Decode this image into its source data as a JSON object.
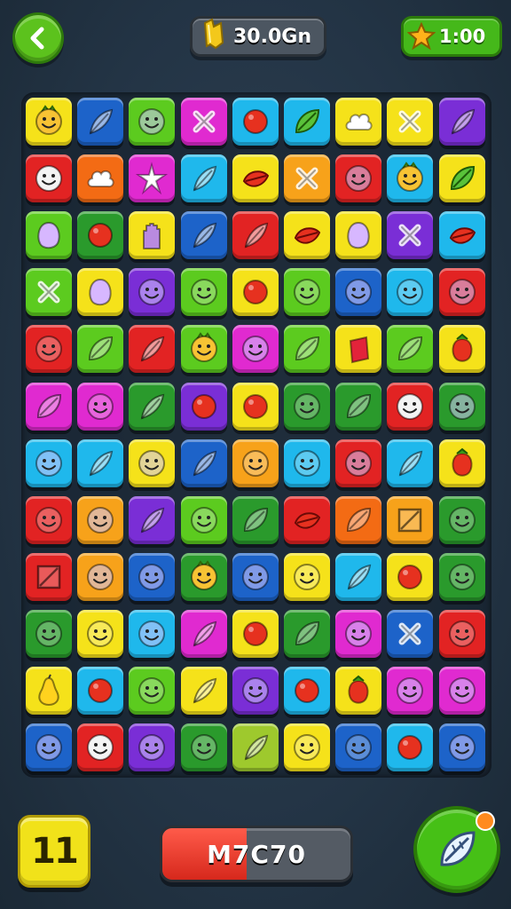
{
  "header": {
    "back_icon": "back-arrow-icon",
    "currency_icon": "gold-bar-icon",
    "currency_value": "30.0Gn",
    "timer_icon": "star-icon",
    "timer_value": "1:00"
  },
  "footer": {
    "level_value": "11",
    "score_value": "M7C70",
    "score_fill_percent": 45,
    "booster_icon": "leaf-booster-icon"
  },
  "colors": {
    "Y": "#f5e21a",
    "B": "#1d63c9",
    "L": "#5ccb1f",
    "M": "#e02ad0",
    "C": "#1fb8ec",
    "R": "#e22323",
    "O": "#f36b14",
    "P": "#7a2ed6",
    "D": "#2a9a2c",
    "A": "#f7a21a",
    "W": "#9ec92d"
  },
  "board": {
    "rows": [
      [
        "Y:pineapple-face",
        "B:feather",
        "L:blob-face",
        "M:cross",
        "C:red-blob",
        "C:green-leaf",
        "Y:cloud",
        "Y:cross",
        "P:feather"
      ],
      [
        "R:white-face",
        "O:cloud",
        "M:star",
        "C:feather",
        "Y:red-leaf",
        "A:cross",
        "R:blob-face",
        "C:pineapple-face",
        "Y:green-leaf"
      ],
      [
        "L:blob",
        "D:red-blob",
        "Y:hand",
        "B:feather",
        "R:feather",
        "Y:red-leaf",
        "Y:blob",
        "P:cross",
        "C:red-leaf"
      ],
      [
        "L:cross",
        "Y:blob",
        "P:blob-face",
        "L:smiley",
        "Y:red-blob",
        "L:smiley",
        "B:blob-face",
        "C:smiley",
        "R:blob-face"
      ],
      [
        "R:smiley",
        "L:leaf",
        "R:feather",
        "L:pineapple-face",
        "M:blob-face",
        "L:leaf",
        "Y:card",
        "L:leaf",
        "Y:berry"
      ],
      [
        "M:leaf",
        "M:smiley",
        "D:feather",
        "P:red-blob",
        "Y:red-blob",
        "D:smiley",
        "D:leaf",
        "R:white-face",
        "D:blob-face"
      ],
      [
        "C:blob-face",
        "C:feather",
        "Y:blob-face",
        "B:feather",
        "A:smiley",
        "C:smiley",
        "R:blob-face",
        "C:feather",
        "Y:berry"
      ],
      [
        "R:smiley",
        "A:blob-face",
        "P:feather",
        "L:smiley",
        "D:leaf",
        "R:red-leaf",
        "O:leaf",
        "A:square",
        "D:smiley"
      ],
      [
        "R:square",
        "A:blob-face",
        "B:blob-face",
        "D:pineapple-face",
        "B:blob-face",
        "Y:smiley",
        "C:feather",
        "Y:red-blob",
        "D:smiley"
      ],
      [
        "D:smiley",
        "Y:smiley",
        "C:blob-face",
        "M:feather",
        "Y:red-blob",
        "D:leaf",
        "M:blob-face",
        "B:cross",
        "R:smiley"
      ],
      [
        "Y:pear",
        "C:red-blob",
        "L:smiley",
        "Y:feather",
        "P:blob-face",
        "C:red-blob",
        "Y:berry",
        "M:blob-face",
        "M:blob-face"
      ],
      [
        "B:blob-face",
        "R:white-face",
        "P:blob-face",
        "D:smiley",
        "W:feather",
        "Y:smiley",
        "B:smiley",
        "C:red-blob",
        "B:blob-face"
      ]
    ]
  }
}
